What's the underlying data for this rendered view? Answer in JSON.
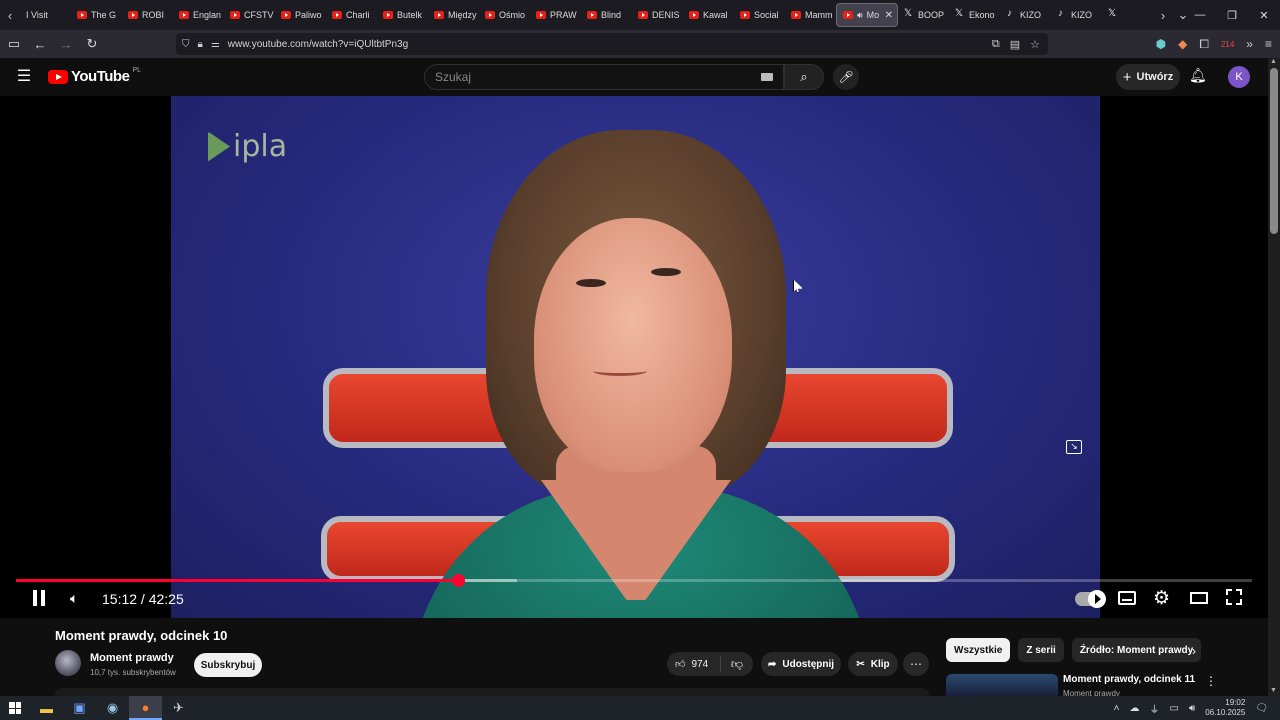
{
  "browser": {
    "tabs": [
      {
        "label": "I Visit",
        "icon": "none"
      },
      {
        "label": "The G",
        "icon": "youtube-icon"
      },
      {
        "label": "ROBI",
        "icon": "youtube-icon"
      },
      {
        "label": "Englan",
        "icon": "youtube-icon"
      },
      {
        "label": "CFSTV",
        "icon": "youtube-icon"
      },
      {
        "label": "Paliwo",
        "icon": "youtube-icon"
      },
      {
        "label": "Charli",
        "icon": "youtube-icon"
      },
      {
        "label": "Butelk",
        "icon": "youtube-icon"
      },
      {
        "label": "Między",
        "icon": "youtube-icon"
      },
      {
        "label": "Ośmio",
        "icon": "youtube-icon"
      },
      {
        "label": "PRAW",
        "icon": "youtube-icon"
      },
      {
        "label": "Blind",
        "icon": "youtube-icon"
      },
      {
        "label": "DENIS",
        "icon": "youtube-icon"
      },
      {
        "label": "Kawal",
        "icon": "youtube-icon"
      },
      {
        "label": "Social",
        "icon": "youtube-icon"
      },
      {
        "label": "Mamm",
        "icon": "youtube-icon"
      },
      {
        "label": "Mo",
        "icon": "youtube-icon",
        "active": true
      },
      {
        "label": "BOOP",
        "icon": "x-icon"
      },
      {
        "label": "Ekono",
        "icon": "x-icon"
      },
      {
        "label": "KIZO",
        "icon": "tiktok-icon"
      },
      {
        "label": "KIZO",
        "icon": "tiktok-icon"
      },
      {
        "label": "",
        "icon": "x-icon"
      }
    ],
    "url": "www.youtube.com/watch?v=iQUltbtPn3g",
    "badge_count": "214"
  },
  "youtube": {
    "logo_text": "YouTube",
    "country_code": "PL",
    "search_placeholder": "Szukaj",
    "create_label": "Utwórz",
    "avatar_letter": "K"
  },
  "player": {
    "watermark": "ipla",
    "current_time": "15:12",
    "duration": "42:25",
    "time_display": "15:12 / 42:25",
    "played_fraction": 0.358,
    "buffered_fraction": 0.405
  },
  "video": {
    "title": "Moment prawdy, odcinek 10",
    "channel_name": "Moment prawdy",
    "subscribers": "10,7 tys. subskrybentów",
    "subscribe_label": "Subskrybuj",
    "likes": "974",
    "share_label": "Udostępnij",
    "clip_label": "Klip"
  },
  "sidebar": {
    "chips": [
      "Wszystkie",
      "Z serii",
      "Źródło: Moment prawdy"
    ],
    "recommended": {
      "title": "Moment prawdy, odcinek 11",
      "channel": "Moment prawdy"
    }
  },
  "taskbar": {
    "time": "19:02",
    "date": "06.10.2025"
  },
  "colors": {
    "accent": "#ff0033",
    "youtube_red": "#ff0000",
    "background": "#0f0f0f",
    "avatar": "#7b55c7"
  }
}
